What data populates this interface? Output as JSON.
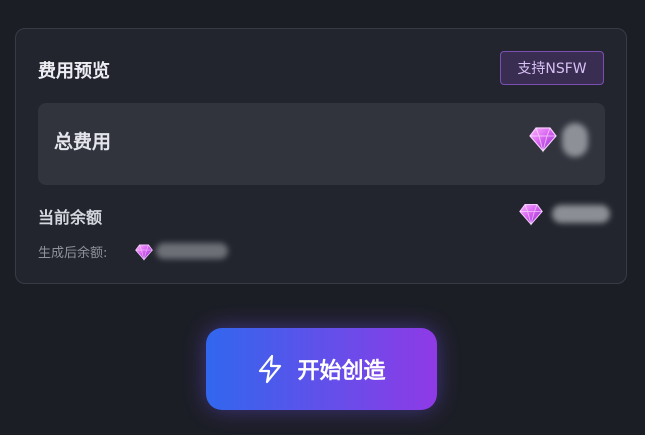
{
  "preview": {
    "title": "费用预览",
    "nsfw_badge": "支持NSFW",
    "total_label": "总费用",
    "balance_label": "当前余额",
    "after_label": "生成后余额:",
    "gem_icon": "gem-icon"
  },
  "actions": {
    "start_label": "开始创造",
    "start_icon": "lightning-icon"
  },
  "colors": {
    "accent_start": "#3167ee",
    "accent_end": "#8f3ae6",
    "gem": "#d56ef0"
  }
}
